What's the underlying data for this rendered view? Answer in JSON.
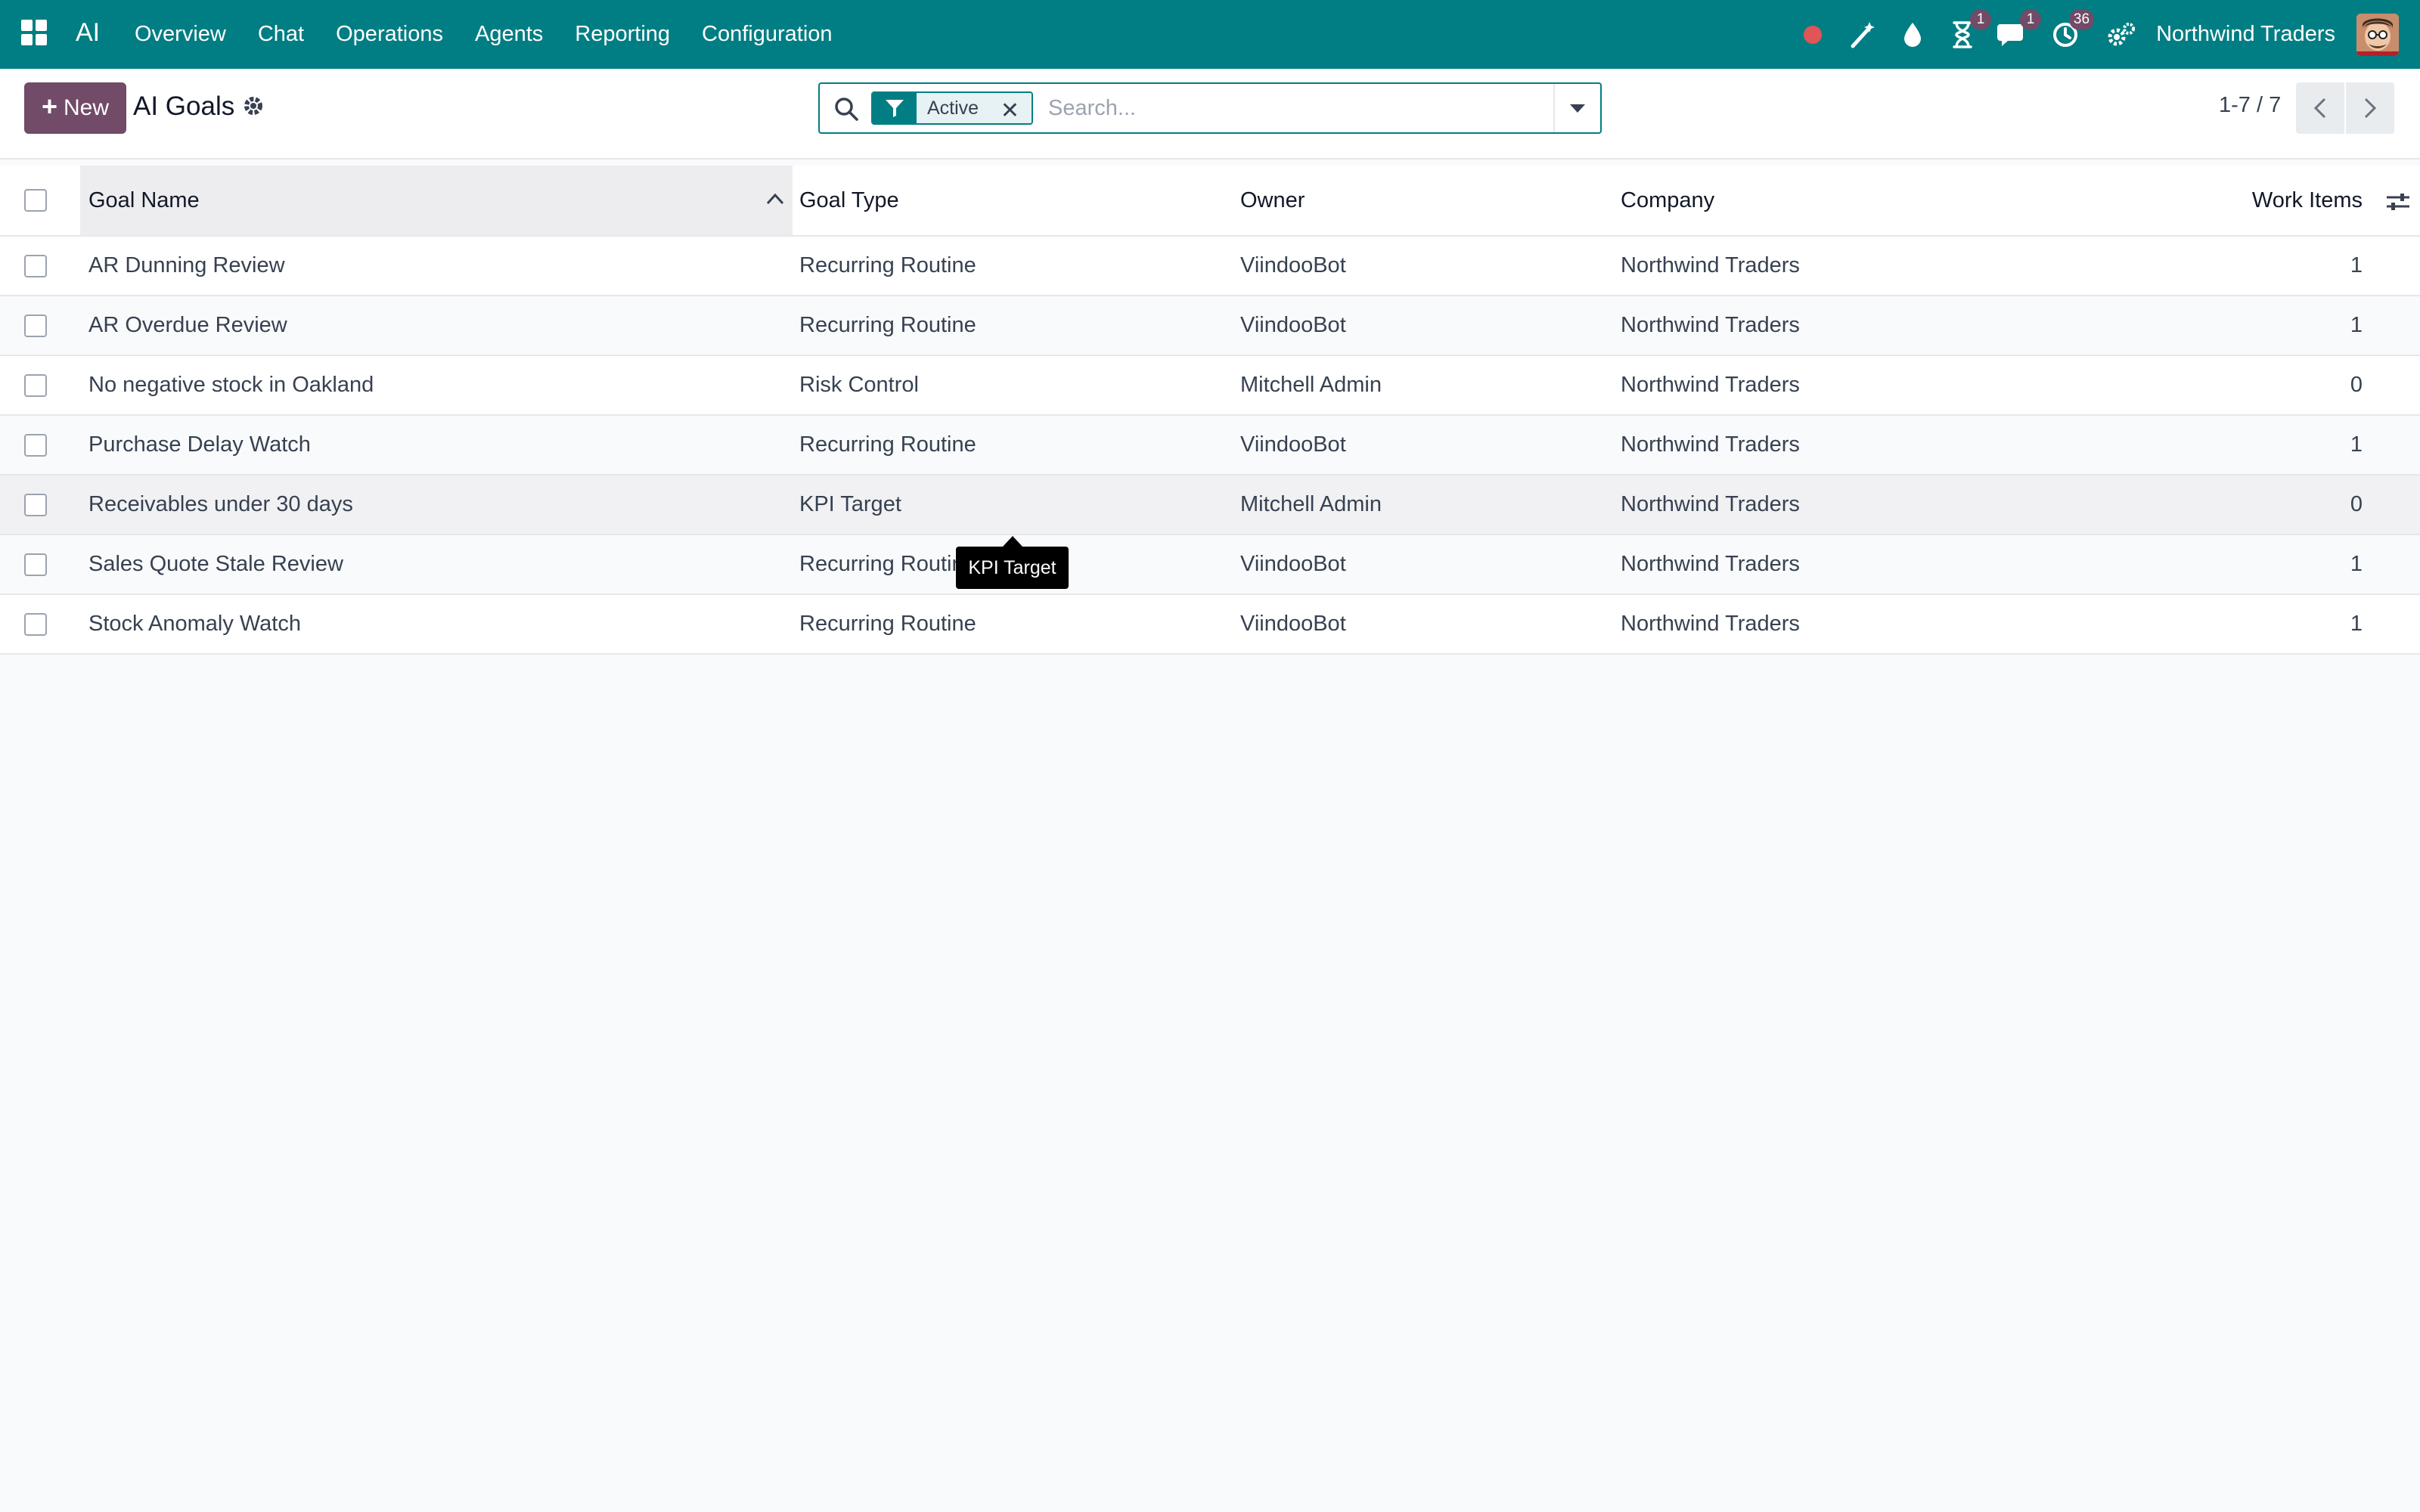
{
  "navbar": {
    "brand": "AI",
    "menu": [
      "Overview",
      "Chat",
      "Operations",
      "Agents",
      "Reporting",
      "Configuration"
    ],
    "badges": {
      "activities": "1",
      "messages": "1",
      "timer": "36"
    },
    "company": "Northwind Traders",
    "icons": [
      "record-dot-icon",
      "magic-wand-icon",
      "droplet-icon",
      "hourglass-icon",
      "chat-icon",
      "clock-icon",
      "gears-icon"
    ],
    "colors": {
      "navbar": "#017e84",
      "badge": "#714b67",
      "record": "#e05555"
    }
  },
  "control": {
    "new_label": "New",
    "title": "AI Goals",
    "facet": "Active",
    "search_placeholder": "Search...",
    "pager": "1-7 / 7"
  },
  "table": {
    "columns": {
      "name": "Goal Name",
      "type": "Goal Type",
      "owner": "Owner",
      "company": "Company",
      "work": "Work Items"
    },
    "rows": [
      {
        "name": "AR Dunning Review",
        "type": "Recurring Routine",
        "owner": "ViindooBot",
        "company": "Northwind Traders",
        "work": "1"
      },
      {
        "name": "AR Overdue Review",
        "type": "Recurring Routine",
        "owner": "ViindooBot",
        "company": "Northwind Traders",
        "work": "1"
      },
      {
        "name": "No negative stock in Oakland",
        "type": "Risk Control",
        "owner": "Mitchell Admin",
        "company": "Northwind Traders",
        "work": "0"
      },
      {
        "name": "Purchase Delay Watch",
        "type": "Recurring Routine",
        "owner": "ViindooBot",
        "company": "Northwind Traders",
        "work": "1"
      },
      {
        "name": "Receivables under 30 days",
        "type": "KPI Target",
        "owner": "Mitchell Admin",
        "company": "Northwind Traders",
        "work": "0"
      },
      {
        "name": "Sales Quote Stale Review",
        "type": "Recurring Routine",
        "owner": "ViindooBot",
        "company": "Northwind Traders",
        "work": "1"
      },
      {
        "name": "Stock Anomaly Watch",
        "type": "Recurring Routine",
        "owner": "ViindooBot",
        "company": "Northwind Traders",
        "work": "1"
      }
    ]
  },
  "tooltip": "KPI Target"
}
